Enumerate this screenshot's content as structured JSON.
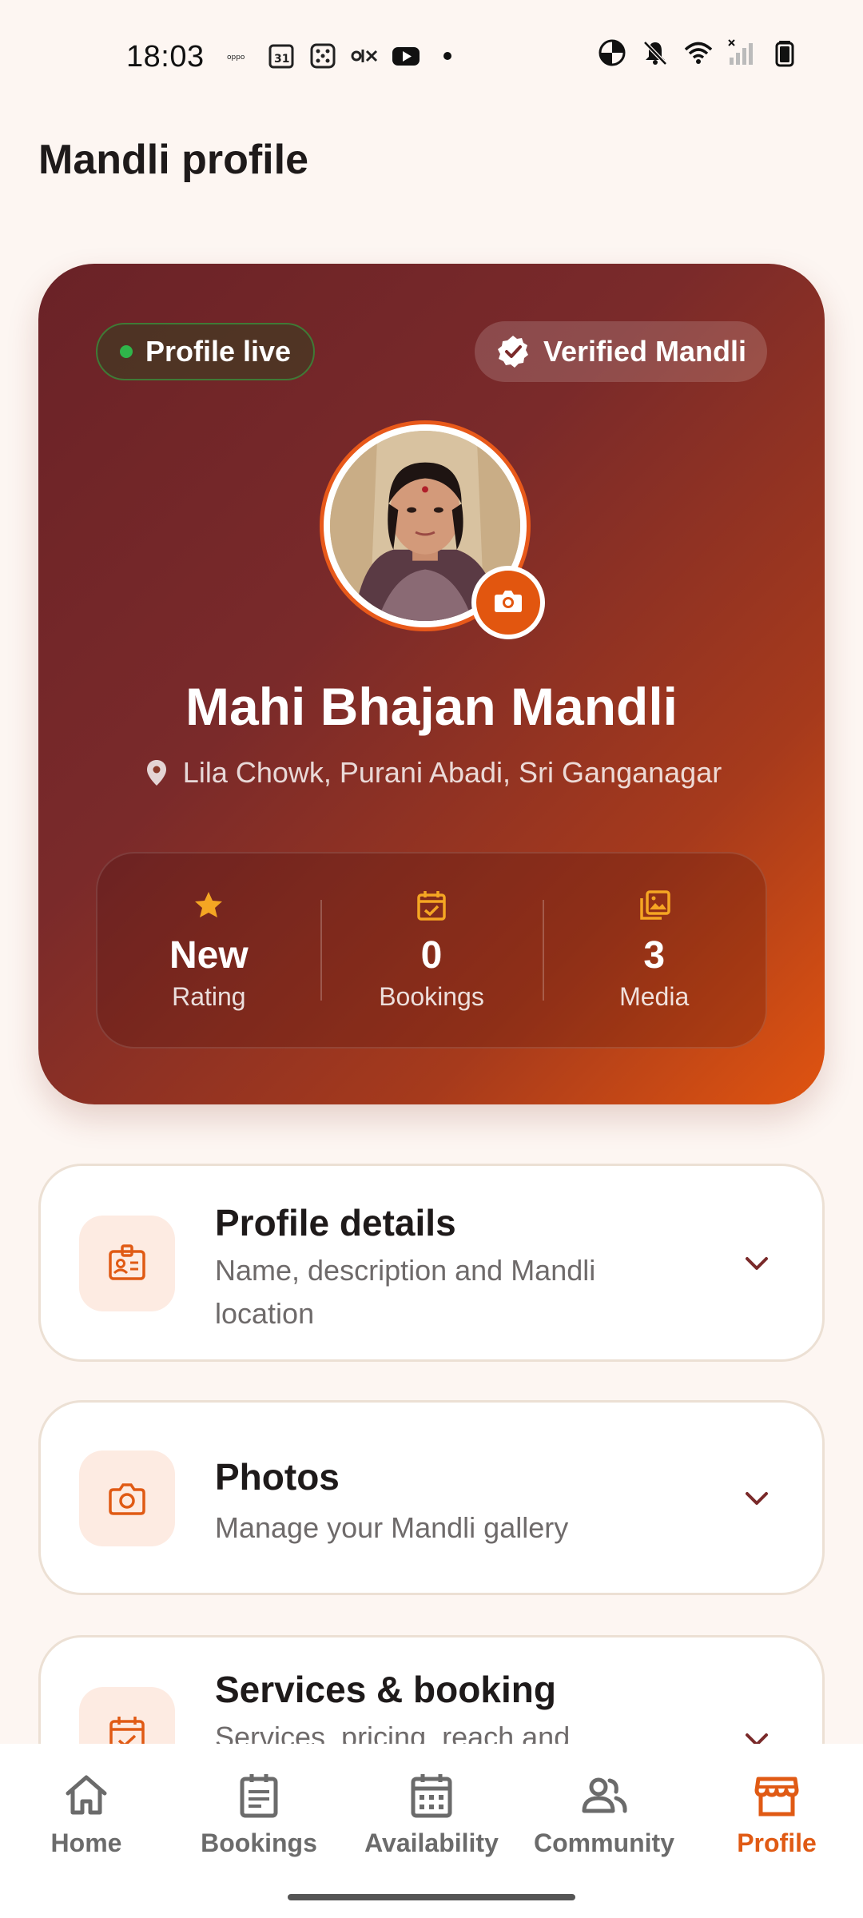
{
  "status_bar": {
    "time": "18:03",
    "left_icons": [
      "oppo-icon",
      "calendar-31-icon",
      "dice-icon",
      "olx-icon",
      "youtube-icon",
      "dot-icon"
    ],
    "right_icons": [
      "data-saver-icon",
      "mute-icon",
      "wifi-icon",
      "signal-icon",
      "battery-icon"
    ],
    "calendar_day": "31"
  },
  "header": {
    "title": "Mandli profile"
  },
  "hero": {
    "live_badge": "Profile live",
    "verified_badge": "Verified Mandli",
    "name": "Mahi Bhajan Mandli",
    "location": "Lila Chowk, Purani Abadi, Sri Ganganagar",
    "stats": [
      {
        "icon": "star-icon",
        "value": "New",
        "label": "Rating"
      },
      {
        "icon": "calendar-check-icon",
        "value": "0",
        "label": "Bookings"
      },
      {
        "icon": "media-stack-icon",
        "value": "3",
        "label": "Media"
      }
    ]
  },
  "sections": [
    {
      "icon": "id-badge-icon",
      "title": "Profile details",
      "subtitle": "Name, description and Mandli location"
    },
    {
      "icon": "camera-icon",
      "title": "Photos",
      "subtitle": "Manage your Mandli gallery"
    },
    {
      "icon": "calendar-check-icon",
      "title": "Services & booking",
      "subtitle": "Services, pricing, reach and"
    }
  ],
  "bottom_nav": {
    "items": [
      {
        "icon": "home-icon",
        "label": "Home"
      },
      {
        "icon": "bookings-icon",
        "label": "Bookings"
      },
      {
        "icon": "calendar-icon",
        "label": "Availability"
      },
      {
        "icon": "community-icon",
        "label": "Community"
      },
      {
        "icon": "store-icon",
        "label": "Profile"
      }
    ],
    "active": "Profile"
  },
  "colors": {
    "accent": "#e05a14",
    "hero_gradient_start": "#6a2227",
    "hero_gradient_end": "#e05410",
    "live_dot": "#2fb54a",
    "stat_icon": "#f5a623"
  }
}
